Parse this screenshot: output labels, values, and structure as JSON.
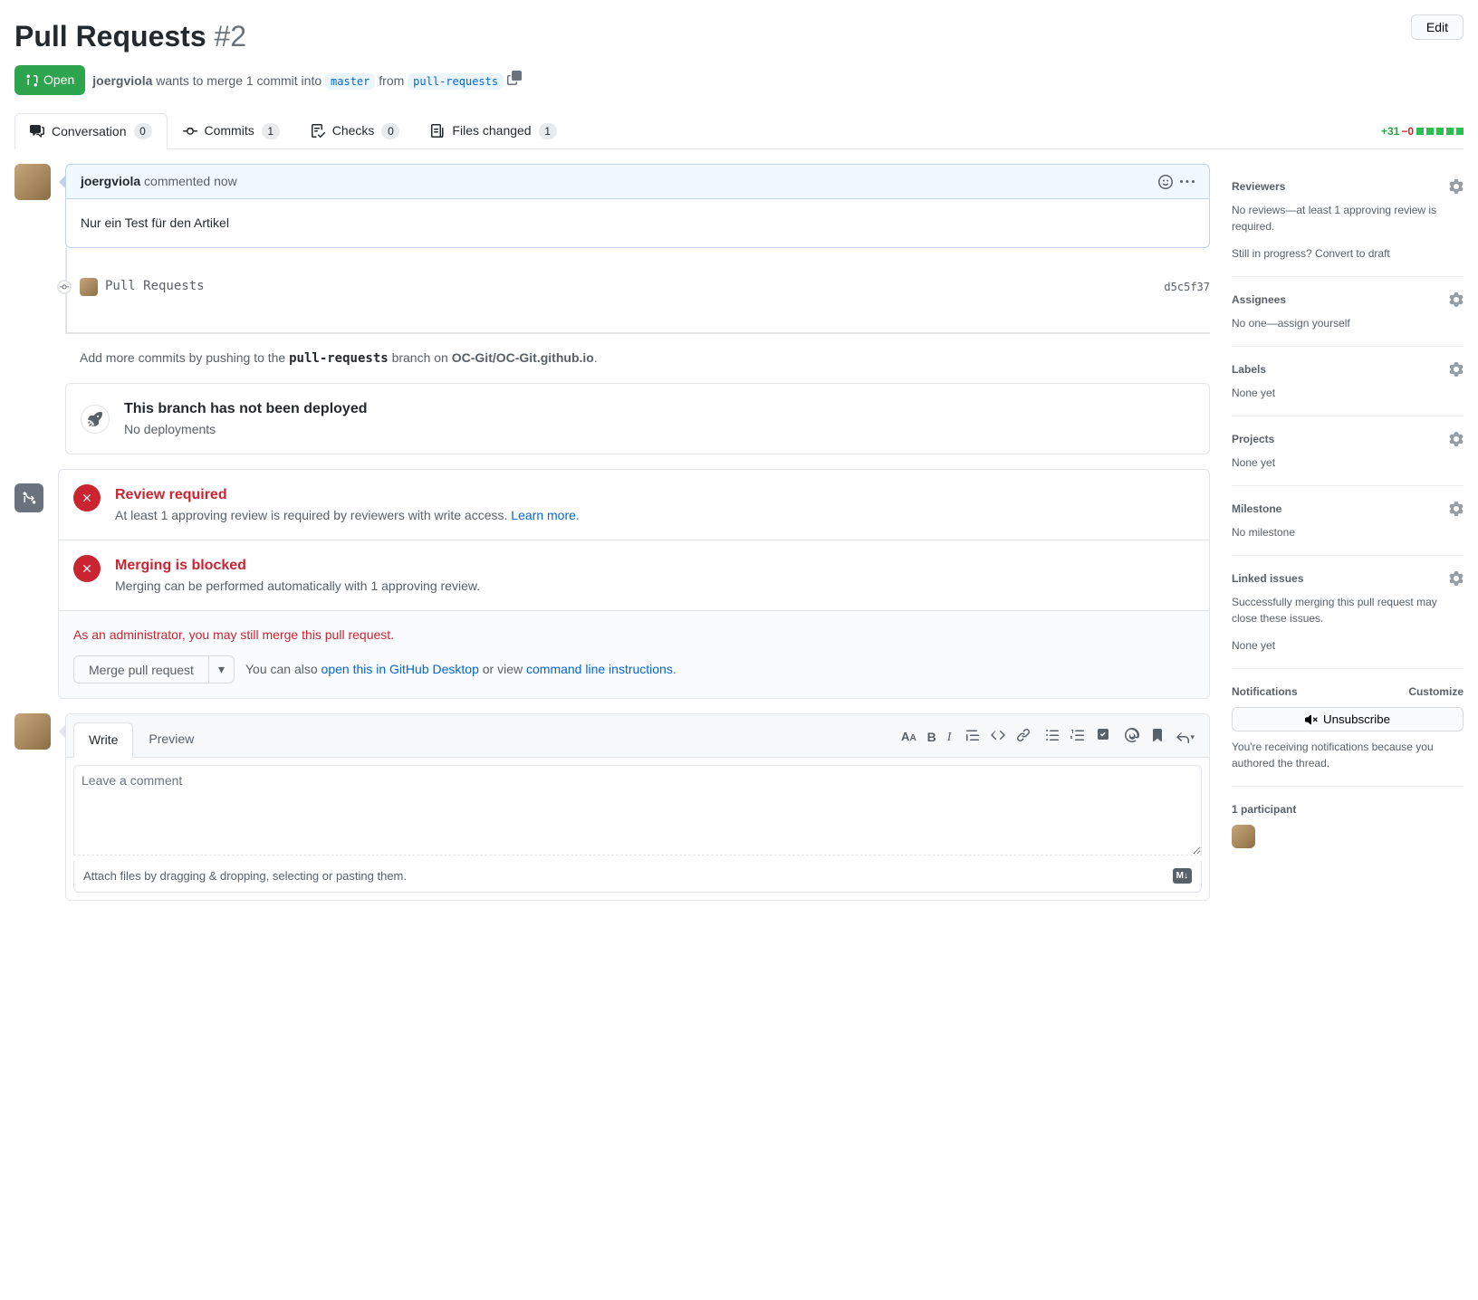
{
  "header": {
    "title": "Pull Requests",
    "number": "#2",
    "edit_label": "Edit",
    "state": "Open",
    "author": "joergviola",
    "meta_text_1": "wants to merge 1 commit into",
    "base_branch": "master",
    "from_text": "from",
    "compare_branch": "pull-requests"
  },
  "tabs": {
    "conversation": {
      "label": "Conversation",
      "count": "0"
    },
    "commits": {
      "label": "Commits",
      "count": "1"
    },
    "checks": {
      "label": "Checks",
      "count": "0"
    },
    "files": {
      "label": "Files changed",
      "count": "1"
    }
  },
  "diffstat": {
    "additions": "+31",
    "deletions": "−0"
  },
  "comment": {
    "author": "joergviola",
    "timestamp_text": "commented now",
    "body": "Nur ein Test für den Artikel"
  },
  "commit": {
    "message": "Pull Requests",
    "sha": "d5c5f37"
  },
  "push_hint": {
    "prefix": "Add more commits by pushing to the ",
    "branch": "pull-requests",
    "mid": " branch on ",
    "repo": "OC-Git/OC-Git.github.io",
    "suffix": "."
  },
  "deploy": {
    "title": "This branch has not been deployed",
    "subtitle": "No deployments"
  },
  "merge": {
    "review_title": "Review required",
    "review_text": "At least 1 approving review is required by reviewers with write access. ",
    "learn_more": "Learn more",
    "blocked_title": "Merging is blocked",
    "blocked_text": "Merging can be performed automatically with 1 approving review.",
    "admin_text": "As an administrator, you may still merge this pull request.",
    "merge_button": "Merge pull request",
    "hint_prefix": "You can also ",
    "hint_desktop": "open this in GitHub Desktop",
    "hint_mid": " or view ",
    "hint_cli": "command line instructions",
    "hint_suffix": "."
  },
  "comment_form": {
    "write_tab": "Write",
    "preview_tab": "Preview",
    "placeholder": "Leave a comment",
    "attach_hint": "Attach files by dragging & dropping, selecting or pasting them.",
    "md_badge": "M↓"
  },
  "sidebar": {
    "reviewers": {
      "title": "Reviewers",
      "text": "No reviews—at least 1 approving review is required.",
      "draft_text": "Still in progress? ",
      "convert_link": "Convert to draft"
    },
    "assignees": {
      "title": "Assignees",
      "text_prefix": "No one—",
      "assign_link": "assign yourself"
    },
    "labels": {
      "title": "Labels",
      "text": "None yet"
    },
    "projects": {
      "title": "Projects",
      "text": "None yet"
    },
    "milestone": {
      "title": "Milestone",
      "text": "No milestone"
    },
    "linked": {
      "title": "Linked issues",
      "desc": "Successfully merging this pull request may close these issues.",
      "text": "None yet"
    },
    "notifications": {
      "title": "Notifications",
      "customize": "Customize",
      "unsubscribe": "Unsubscribe",
      "desc": "You're receiving notifications because you authored the thread."
    },
    "participants": {
      "title": "1 participant"
    }
  }
}
